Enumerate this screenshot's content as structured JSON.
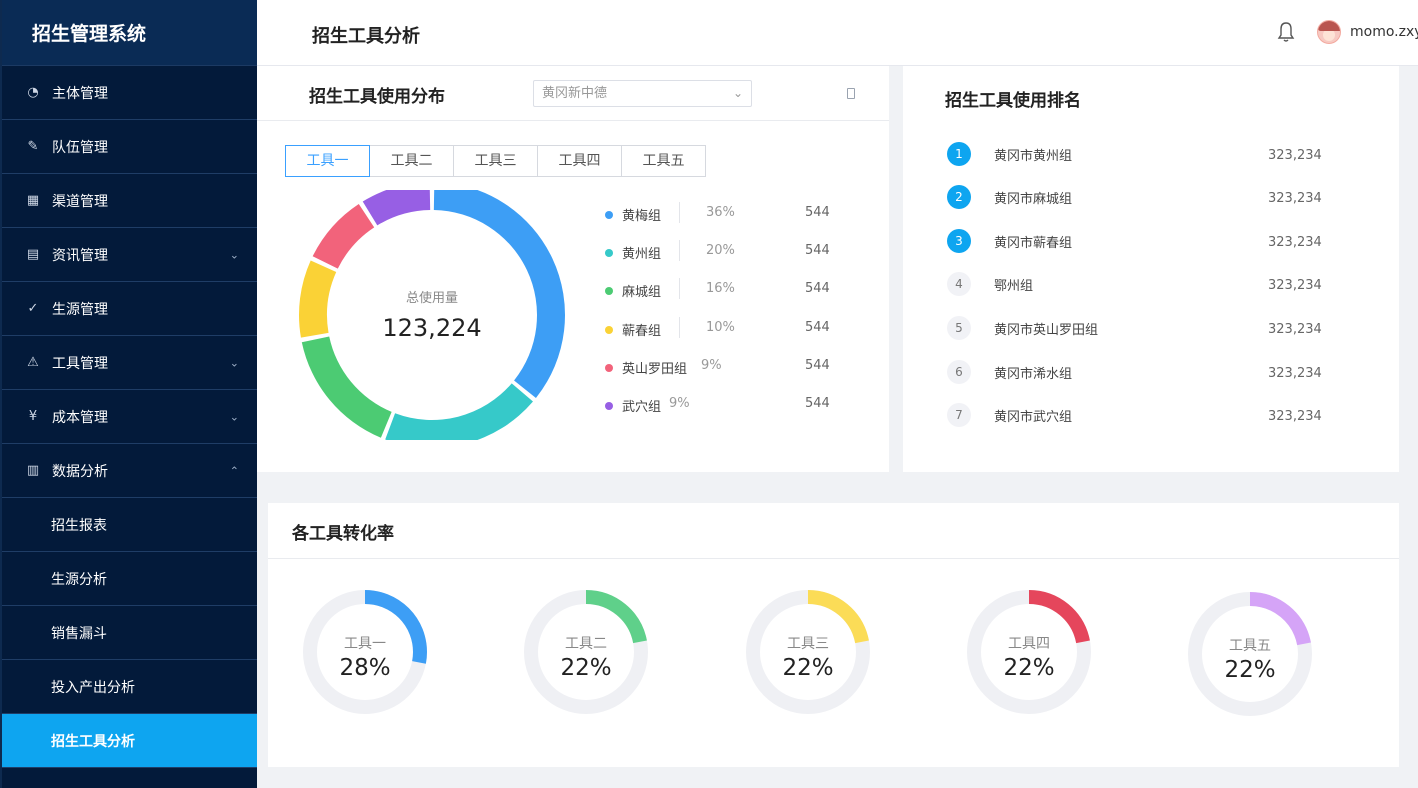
{
  "sidebar": {
    "logo": "招生管理系统",
    "items": [
      {
        "label": "主体管理",
        "icon": "gauge-icon",
        "glyph": "◔",
        "chevron": ""
      },
      {
        "label": "队伍管理",
        "icon": "edit-icon",
        "glyph": "✎",
        "chevron": ""
      },
      {
        "label": "渠道管理",
        "icon": "table-icon",
        "glyph": "▦",
        "chevron": ""
      },
      {
        "label": "资讯管理",
        "icon": "document-icon",
        "glyph": "▤",
        "chevron": "⌄"
      },
      {
        "label": "生源管理",
        "icon": "check-circle-icon",
        "glyph": "✓",
        "chevron": ""
      },
      {
        "label": "工具管理",
        "icon": "warning-icon",
        "glyph": "⚠",
        "chevron": "⌄"
      },
      {
        "label": "成本管理",
        "icon": "yen-icon",
        "glyph": "¥",
        "chevron": "⌄"
      },
      {
        "label": "数据分析",
        "icon": "bar-chart-icon",
        "glyph": "▥",
        "chevron": "⌃"
      }
    ],
    "sub_items": [
      "招生报表",
      "生源分析",
      "销售漏斗",
      "投入产出分析",
      "招生工具分析"
    ]
  },
  "header": {
    "title": "招生工具分析",
    "username": "momo.zxy"
  },
  "distribution": {
    "title": "招生工具使用分布",
    "select_value": "黄冈新中德",
    "tabs": [
      "工具一",
      "工具二",
      "工具三",
      "工具四",
      "工具五"
    ],
    "center_label": "总使用量",
    "center_value": "123,224",
    "legend": [
      {
        "name": "黄梅组",
        "pct": "36%",
        "count": "544",
        "color": "#3d9ef5"
      },
      {
        "name": "黄州组",
        "pct": "20%",
        "count": "544",
        "color": "#36c9c9"
      },
      {
        "name": "麻城组",
        "pct": "16%",
        "count": "544",
        "color": "#4ccb73"
      },
      {
        "name": "蕲春组",
        "pct": "10%",
        "count": "544",
        "color": "#fad236"
      },
      {
        "name": "英山罗田组",
        "pct": "9%",
        "count": "544",
        "color": "#f2637b"
      },
      {
        "name": "武穴组",
        "pct": "9%",
        "count": "544",
        "color": "#975fe4"
      }
    ]
  },
  "ranking": {
    "title": "招生工具使用排名",
    "rows": [
      {
        "rank": "1",
        "name": "黄冈市黄州组",
        "value": "323,234"
      },
      {
        "rank": "2",
        "name": "黄冈市麻城组",
        "value": "323,234"
      },
      {
        "rank": "3",
        "name": "黄冈市蕲春组",
        "value": "323,234"
      },
      {
        "rank": "4",
        "name": "鄂州组",
        "value": "323,234"
      },
      {
        "rank": "5",
        "name": "黄冈市英山罗田组",
        "value": "323,234"
      },
      {
        "rank": "6",
        "name": "黄冈市浠水组",
        "value": "323,234"
      },
      {
        "rank": "7",
        "name": "黄冈市武穴组",
        "value": "323,234"
      }
    ]
  },
  "conversion": {
    "title": "各工具转化率",
    "tools": [
      {
        "label": "工具一",
        "value": "28%",
        "fraction": 0.28,
        "color": "#3d9ef5"
      },
      {
        "label": "工具二",
        "value": "22%",
        "fraction": 0.22,
        "color": "#5fd08a"
      },
      {
        "label": "工具三",
        "value": "22%",
        "fraction": 0.22,
        "color": "#fbdc57"
      },
      {
        "label": "工具四",
        "value": "22%",
        "fraction": 0.22,
        "color": "#e5465c"
      },
      {
        "label": "工具五",
        "value": "22%",
        "fraction": 0.22,
        "color": "#d5a4f7"
      }
    ]
  }
}
